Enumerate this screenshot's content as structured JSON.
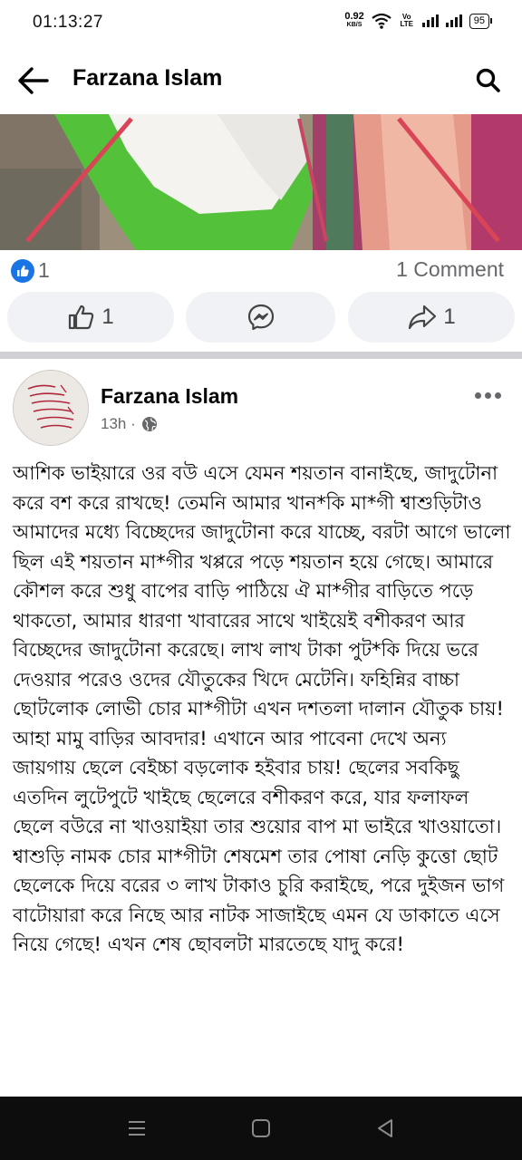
{
  "status": {
    "time": "01:13:27",
    "net_speed": "0.92",
    "net_unit": "KB/S",
    "volte": "Vo LTE",
    "battery": "95"
  },
  "header": {
    "title": "Farzana Islam"
  },
  "reactions": {
    "likes": "1",
    "comments": "1 Comment"
  },
  "actions": {
    "like": "1",
    "share": "1"
  },
  "post": {
    "author": "Farzana Islam",
    "time": "13h · ",
    "text": "আশিক ভাইয়ারে ওর বউ এসে যেমন শয়তান বানাইছে, জাদুটোনা করে বশ করে রাখছে! তেমনি আমার খান*কি মা*গী শ্বাশুড়িটাও আমাদের মধ্যে বিচ্ছেদের জাদুটোনা করে যাচ্ছে, বরটা আগে ভালো ছিল এই শয়তান মা*গীর খপ্পরে পড়ে শয়তান হয়ে গেছে। আমারে কৌশল করে শুধু বাপের বাড়ি পাঠিয়ে ঐ মা*গীর বাড়িতে পড়ে থাকতো, আমার ধারণা খাবারের সাথে খাইয়েই বশীকরণ আর বিচ্ছেদের জাদুটোনা করেছে। লাখ লাখ টাকা পুট*কি দিয়ে ভরে দেওয়ার পরেও ওদের যৌতুকের খিদে মেটেনি। ফহিন্নির বাচ্চা ছোটলোক লোভী চোর মা*গীটা এখন দশতলা দালান যৌতুক চায়! আহা মামু বাড়ির আবদার! এখানে আর পাবেনা দেখে অন্য জায়গায় ছেলে বেইচ্চা বড়লোক হইবার চায়! ছেলের সবকিছু এতদিন লুটেপুটে খাইছে ছেলেরে বশীকরণ করে, যার ফলাফল ছেলে বউরে না খাওয়াইয়া তার শুয়োর বাপ মা ভাইরে খাওয়াতো। শ্বাশুড়ি নামক চোর মা*গীটা শেষমেশ তার পোষা নেড়ি কুত্তো ছোট ছেলেকে দিয়ে বরের ৩ লাখ টাকাও চুরি করাইছে, পরে দুইজন ভাগ বাটোয়ারা করে নিছে আর নাটক সাজাইছে এমন যে ডাকাতে এসে নিয়ে গেছে! এখন শেষ ছোবলটা মারতেছে যাদু করে!"
  },
  "colors": {
    "brand_blue": "#1b74e4",
    "secondary_text": "#65676b",
    "button_bg": "#f0f2f5"
  },
  "icons": {
    "back": "arrow-left-icon",
    "search": "search-icon",
    "like_badge": "thumbs-up-icon",
    "like": "thumbs-up-outline-icon",
    "messenger": "messenger-icon",
    "share": "share-arrow-icon",
    "audience": "globe-icon",
    "more": "more-dots-icon"
  }
}
